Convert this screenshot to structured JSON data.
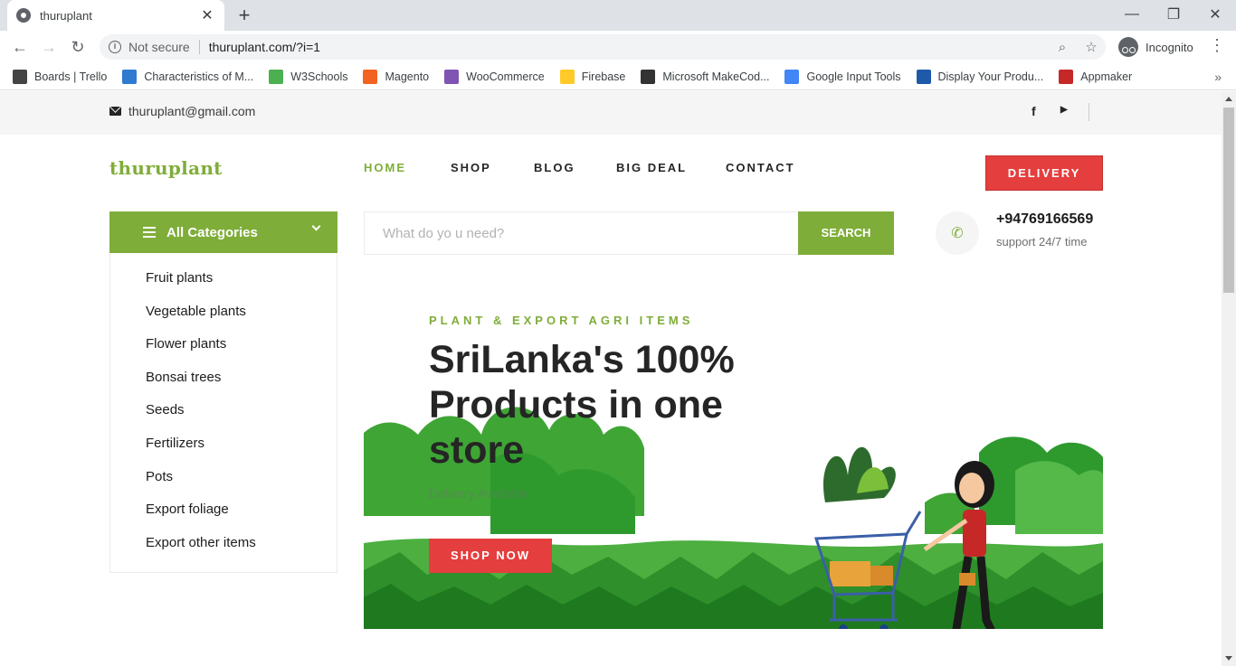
{
  "browser": {
    "tab_title": "thuruplant",
    "security_label": "Not secure",
    "url": "thuruplant.com/?i=1",
    "incognito_label": "Incognito",
    "bookmarks": [
      {
        "label": "Boards | Trello",
        "color": "#444444"
      },
      {
        "label": "Characteristics of M...",
        "color": "#2e7bcf"
      },
      {
        "label": "W3Schools",
        "color": "#4caf50"
      },
      {
        "label": "Magento",
        "color": "#f26322"
      },
      {
        "label": "WooCommerce",
        "color": "#7f54b3"
      },
      {
        "label": "Firebase",
        "color": "#ffca28"
      },
      {
        "label": "Microsoft MakeCod...",
        "color": "#333333"
      },
      {
        "label": "Google Input Tools",
        "color": "#4285f4"
      },
      {
        "label": "Display Your Produ...",
        "color": "#1e5aa8"
      },
      {
        "label": "Appmaker",
        "color": "#c62828"
      }
    ]
  },
  "topbar": {
    "email": "thuruplant@gmail.com",
    "facebook_label": "f",
    "youtube_label": "▶"
  },
  "header": {
    "logo": "thuruplant",
    "nav": [
      {
        "label": "HOME",
        "active": true
      },
      {
        "label": "SHOP",
        "active": false
      },
      {
        "label": "BLOG",
        "active": false
      },
      {
        "label": "BIG DEAL",
        "active": false
      },
      {
        "label": "CONTACT",
        "active": false
      }
    ],
    "delivery_button": "DELIVERY"
  },
  "categories": {
    "title": "All Categories",
    "items": [
      "Fruit plants",
      "Vegetable plants",
      "Flower plants",
      "Bonsai trees",
      "Seeds",
      "Fertilizers",
      "Pots",
      "Export foliage",
      "Export other items"
    ]
  },
  "search": {
    "placeholder": "What do yo u need?",
    "button": "SEARCH"
  },
  "contact": {
    "phone": "+94769166569",
    "support": "support 24/7 time"
  },
  "hero": {
    "subtitle": "PLANT & EXPORT AGRI ITEMS",
    "title": "SriLanka's 100% Products in one store",
    "text": "Delivery Available",
    "button": "SHOP NOW"
  },
  "colors": {
    "brand_green": "#7fad39",
    "accent_red": "#e53e3e"
  }
}
